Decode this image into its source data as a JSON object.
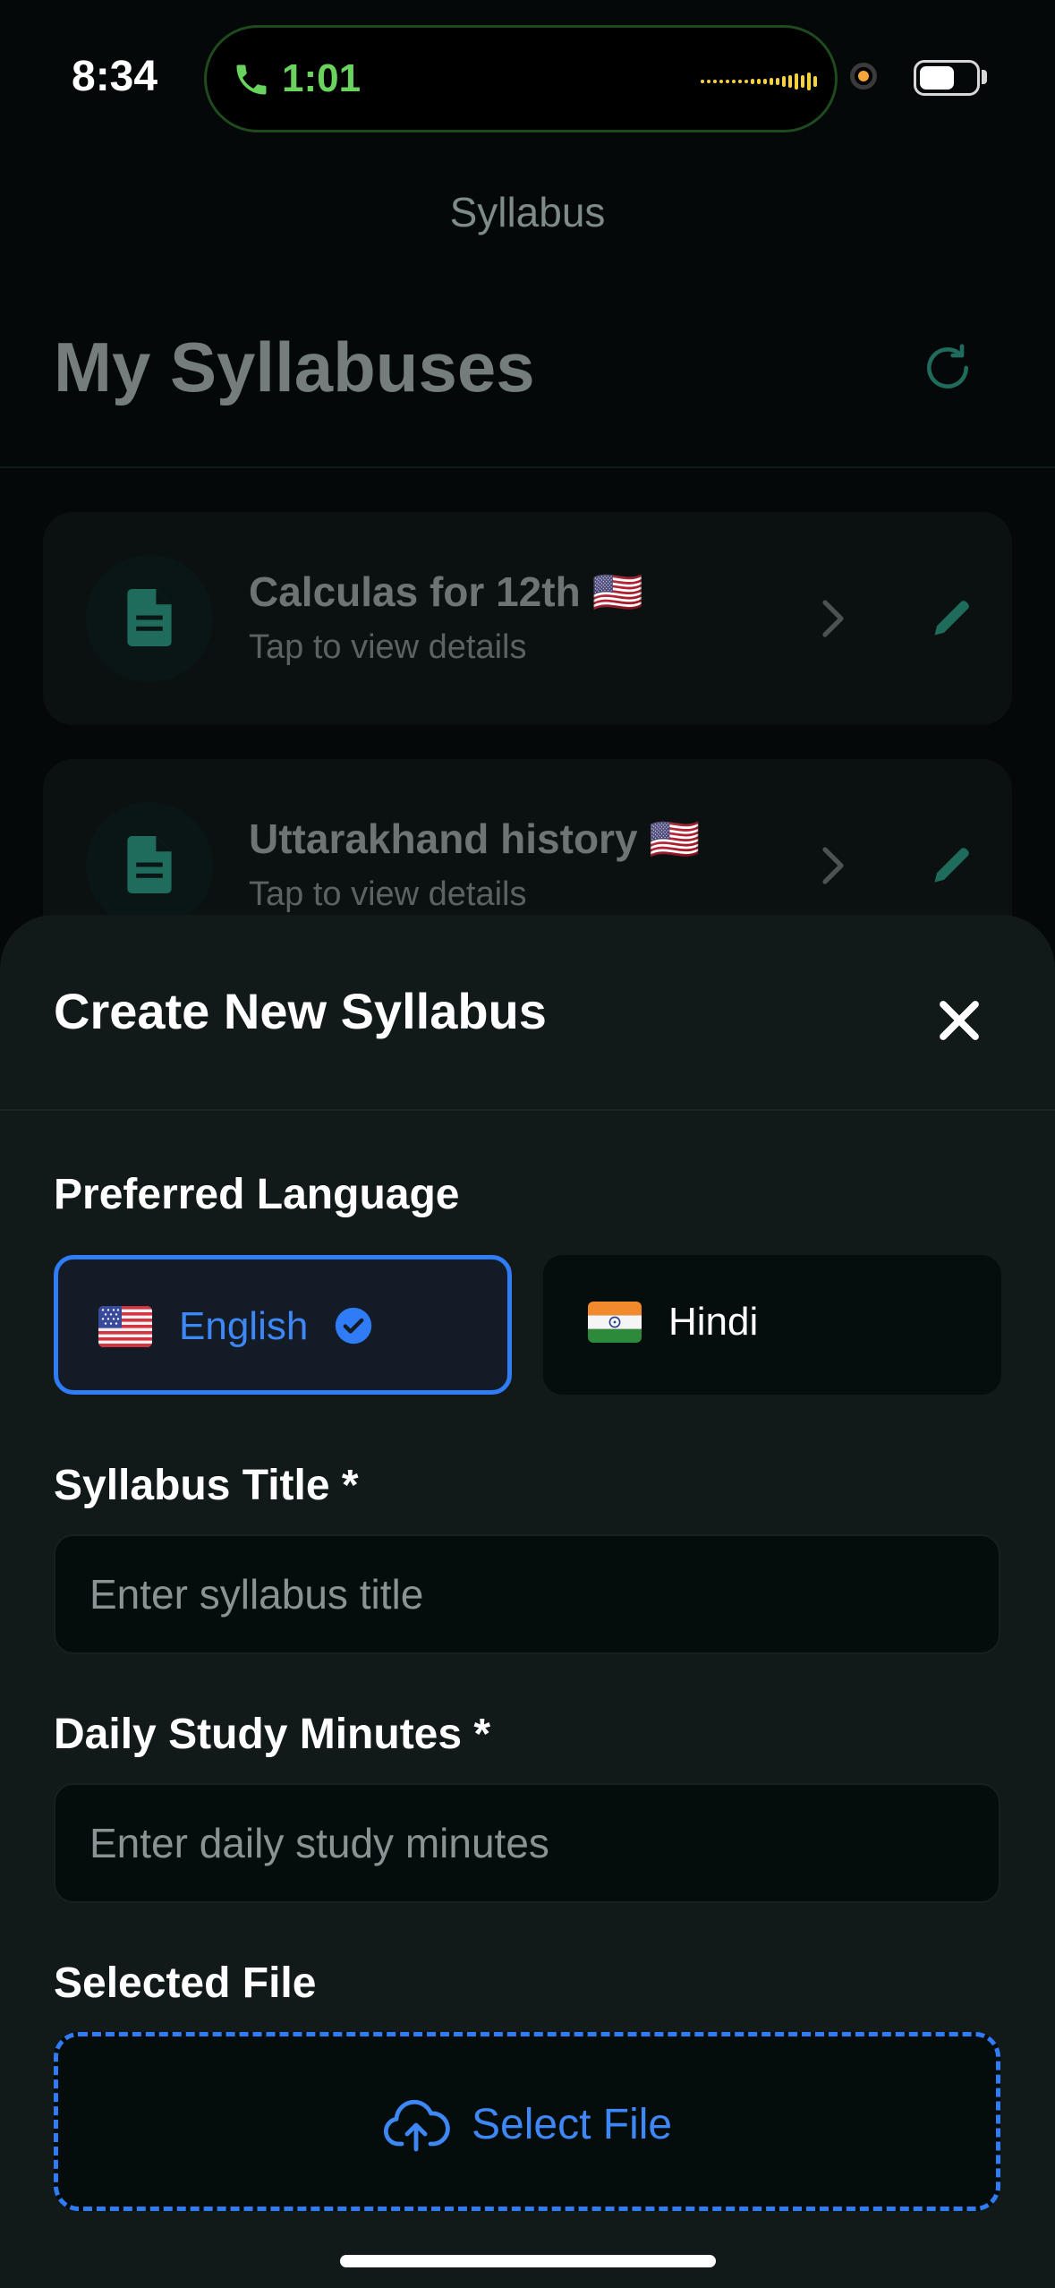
{
  "status_bar": {
    "time": "8:34",
    "call_duration": "1:01",
    "call_color": "#6ad35e"
  },
  "background_screen": {
    "nav_title": "Syllabus",
    "page_title": "My Syllabuses",
    "syllabuses": [
      {
        "title": "Calculas for 12th 🇺🇸",
        "subtitle": "Tap to view details"
      },
      {
        "title": "Uttarakhand history 🇺🇸",
        "subtitle": "Tap to view details"
      }
    ]
  },
  "sheet": {
    "title": "Create New Syllabus",
    "language_label": "Preferred Language",
    "languages": [
      {
        "label": "English",
        "flag": "us-flag",
        "selected": true
      },
      {
        "label": "Hindi",
        "flag": "india-flag",
        "selected": false
      }
    ],
    "title_label": "Syllabus Title *",
    "title_placeholder": "Enter syllabus title",
    "title_value": "",
    "minutes_label": "Daily Study Minutes *",
    "minutes_placeholder": "Enter daily study minutes",
    "minutes_value": "",
    "file_label": "Selected File",
    "select_file_label": "Select File"
  },
  "colors": {
    "accent": "#2f7cf6",
    "background": "#040808",
    "sheet_background": "#111919",
    "icon_green": "#1f6b5c"
  }
}
